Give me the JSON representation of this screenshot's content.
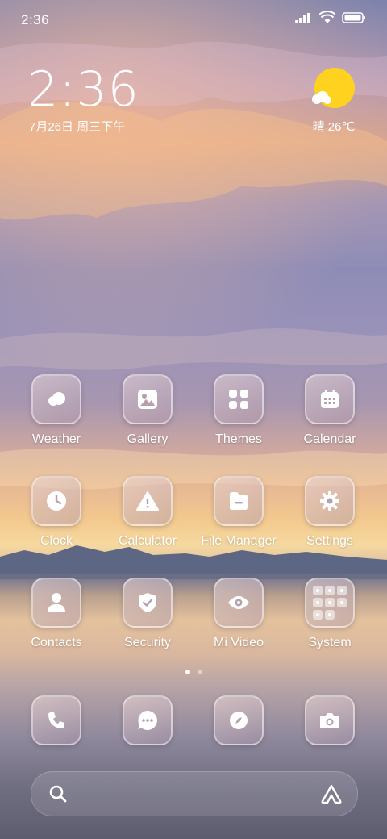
{
  "status_bar": {
    "time": "2:36",
    "icons": [
      "signal-icon",
      "wifi-icon",
      "battery-icon"
    ]
  },
  "clock_widget": {
    "time": "2:36",
    "date": "7月26日 周三下午"
  },
  "weather_widget": {
    "condition_icon": "sun-cloud-icon",
    "text": "晴 26℃"
  },
  "apps": [
    {
      "label": "Weather",
      "icon": "weather-icon"
    },
    {
      "label": "Gallery",
      "icon": "gallery-icon"
    },
    {
      "label": "Themes",
      "icon": "themes-icon"
    },
    {
      "label": "Calendar",
      "icon": "calendar-icon"
    },
    {
      "label": "Clock",
      "icon": "clock-icon"
    },
    {
      "label": "Calculator",
      "icon": "calculator-icon"
    },
    {
      "label": "File Manager",
      "icon": "file-manager-icon"
    },
    {
      "label": "Settings",
      "icon": "gear-icon"
    },
    {
      "label": "Contacts",
      "icon": "contacts-icon"
    },
    {
      "label": "Security",
      "icon": "shield-icon"
    },
    {
      "label": "Mi Video",
      "icon": "eye-icon"
    },
    {
      "label": "System",
      "icon": "folder-grid-icon"
    }
  ],
  "page_indicator": {
    "pages": 2,
    "active": 1
  },
  "dock": [
    {
      "icon": "phone-icon"
    },
    {
      "icon": "message-icon"
    },
    {
      "icon": "browser-compass-icon"
    },
    {
      "icon": "camera-icon"
    }
  ],
  "search_bar": {
    "left_icon": "search-icon",
    "right_icon": "assistant-icon"
  },
  "colors": {
    "sun": "#ffd21f",
    "icon_glyph": "#ffffff"
  }
}
